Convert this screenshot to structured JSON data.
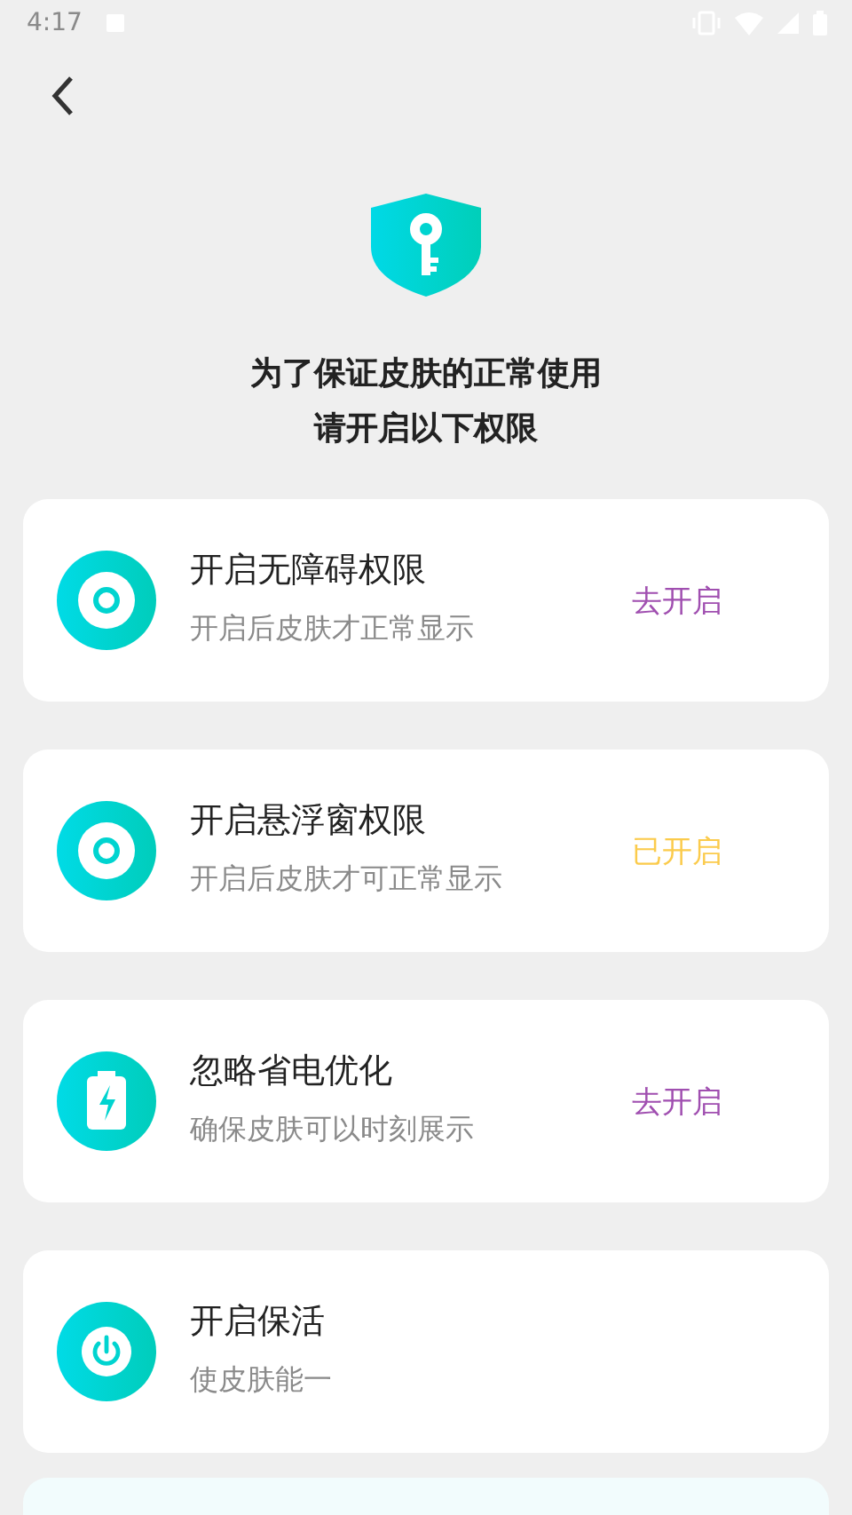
{
  "status_bar": {
    "time": "4:17"
  },
  "header": {
    "title_lines": [
      "为了保证皮肤的正常使用",
      "请开启以下权限"
    ]
  },
  "permissions": [
    {
      "kind": "ring",
      "title": "开启无障碍权限",
      "subtitle": "开启后皮肤才正常显示",
      "action": "去开启",
      "enabled": false
    },
    {
      "kind": "ring",
      "title": "开启悬浮窗权限",
      "subtitle": "开启后皮肤才可正常显示",
      "action": "已开启",
      "enabled": true
    },
    {
      "kind": "battery",
      "title": "忽略省电优化",
      "subtitle": "确保皮肤可以时刻展示",
      "action": "去开启",
      "enabled": false
    },
    {
      "kind": "power",
      "title": "开启保活",
      "subtitle": "使皮肤能一"
    }
  ]
}
